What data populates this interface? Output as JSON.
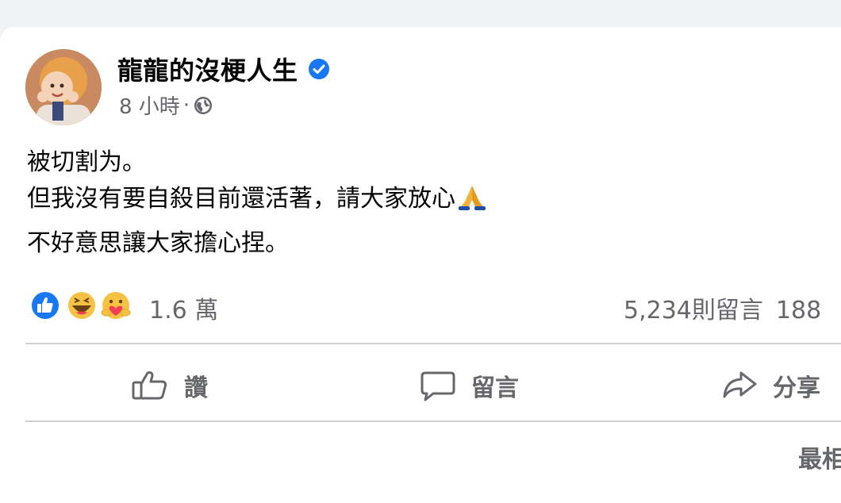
{
  "post": {
    "author": "龍龍的沒梗人生",
    "time": "8 小時",
    "separator": "·",
    "body": {
      "line1": "被切割为。",
      "line2": "但我沒有要自殺目前還活著，請大家放心",
      "line3": "不好意思讓大家擔心捏。"
    },
    "reactions": {
      "icons": [
        "like-icon",
        "haha-icon",
        "care-icon"
      ],
      "count": "1.6 萬"
    },
    "comments_count": "5,234則留言",
    "shares_count": "188"
  },
  "actions": {
    "like_label": "讚",
    "comment_label": "留言",
    "share_label": "分享"
  },
  "sort": {
    "label": "最相"
  },
  "colors": {
    "accent": "#1877f2",
    "secondary_text": "#65676b",
    "divider": "#ced0d4",
    "background": "#f0f2f5"
  }
}
